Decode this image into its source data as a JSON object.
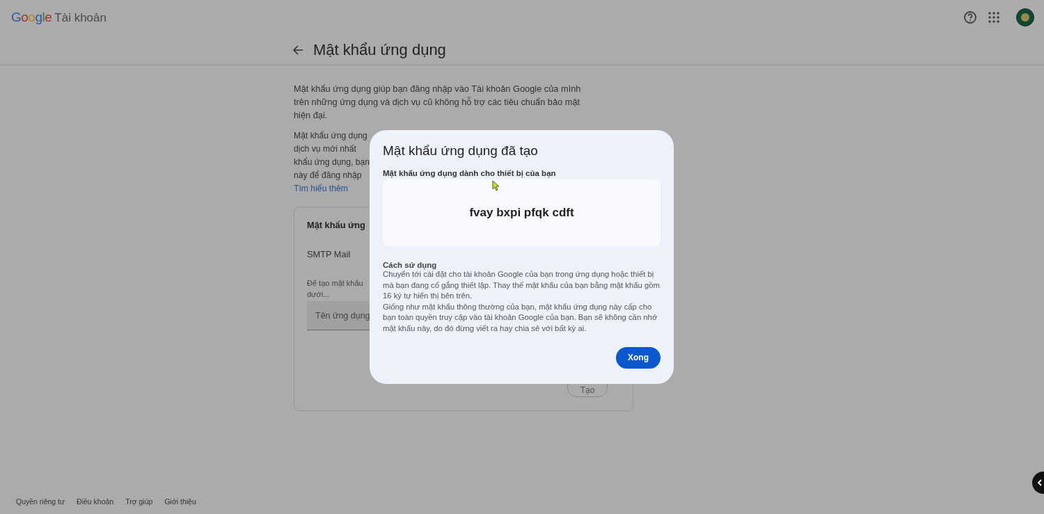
{
  "header": {
    "logo": "Google",
    "product": "Tài khoản"
  },
  "page": {
    "title": "Mật khẩu ứng dụng",
    "intro": "Mật khẩu ứng dụng giúp bạn đăng nhập vào Tài khoản Google của mình trên những ứng dụng và dịch vụ cũ không hỗ trợ các tiêu chuẩn bảo mật hiện đại.",
    "partial_lines": [
      "Mật khẩu ứng dụng",
      "dịch vụ mới nhất",
      "khẩu ứng dụng, bạn",
      "này để đăng nhập"
    ],
    "learn_more": "Tìm hiểu thêm"
  },
  "card": {
    "title": "Mật khẩu ứng",
    "app_name": "SMTP Mail",
    "hint_lines": [
      "Để tạo mật khẩu",
      "dưới..."
    ],
    "input_placeholder": "Tên ứng dụng",
    "create_button": {
      "label": "Tạo",
      "disabled": true
    }
  },
  "dialog": {
    "title": "Mật khẩu ứng dụng đã tạo",
    "password_label": "Mật khẩu ứng dụng dành cho thiết bị của bạn",
    "password": "fvay bxpi pfqk cdft",
    "usage_title": "Cách sử dụng",
    "instructions": [
      "Chuyển tới cài đặt cho tài khoản Google của bạn trong ứng dụng hoặc thiết bị mà bạn đang cố gắng thiết lập. Thay thế mật khẩu của bạn bằng mật khẩu gồm 16 ký tự hiển thị bên trên.",
      "Giống như mật khẩu thông thường của bạn, mật khẩu ứng dụng này cấp cho bạn toàn quyền truy cập vào tài khoản Google của bạn. Bạn sẽ không cần nhớ mật khẩu này, do đó đừng viết ra hay chia sẻ với bất kỳ ai."
    ],
    "done_button": "Xong"
  },
  "footer_links": [
    "Quyền riêng tư",
    "Điều khoản",
    "Trợ giúp",
    "Giới thiệu"
  ]
}
